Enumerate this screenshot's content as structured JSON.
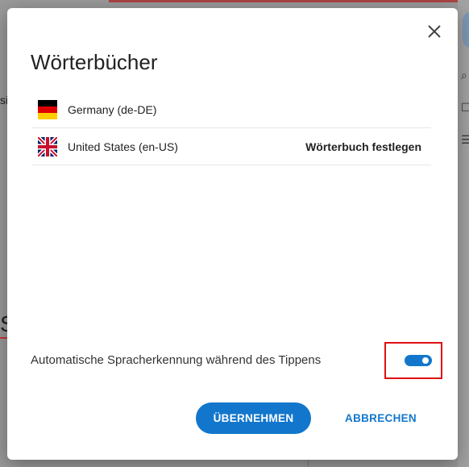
{
  "dialog": {
    "title": "Wörterbücher",
    "close_icon": "close-icon",
    "dictionaries": [
      {
        "label": "Germany (de-DE)",
        "flag": "germany-flag-icon",
        "action": ""
      },
      {
        "label": "United States (en-US)",
        "flag": "uk-flag-icon",
        "action": "Wörterbuch festlegen"
      }
    ],
    "auto_detect": {
      "label": "Automatische Spracherkennung während des Tippens",
      "enabled": true
    },
    "buttons": {
      "apply": "ÜBERNEHMEN",
      "cancel": "ABBRECHEN"
    }
  },
  "colors": {
    "accent": "#1277cc",
    "highlight_border": "#e01010"
  }
}
